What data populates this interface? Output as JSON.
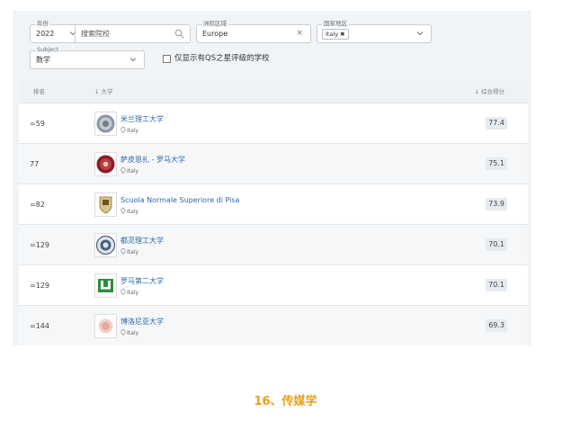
{
  "filters": {
    "year": {
      "legend": "年份",
      "value": "2022"
    },
    "search": {
      "placeholder": "搜索院校"
    },
    "region": {
      "legend": "洲际区域",
      "value": "Europe",
      "clear": "×"
    },
    "country": {
      "legend": "国家地区",
      "chip": "Italy",
      "chip_remove": "✖"
    },
    "subject": {
      "legend": "Subject",
      "value": "数学"
    },
    "qs_only": {
      "label": "仅显示有QS之星评级的学校",
      "checked": false
    }
  },
  "table": {
    "headers": {
      "rank": "排名",
      "university": "↓ 大学",
      "score": "↓ 综合得分"
    },
    "rows": [
      {
        "rank": "=59",
        "name": "米兰理工大学",
        "location": "Italy",
        "score": "77.4",
        "logo_icon": "seal-logo-icon"
      },
      {
        "rank": "77",
        "name": "萨皮恩扎 - 罗马大学",
        "location": "Italy",
        "score": "75.1",
        "logo_icon": "red-seal-logo-icon"
      },
      {
        "rank": "=82",
        "name": "Scuola Normale Superiore di Pisa",
        "location": "Italy",
        "score": "73.9",
        "logo_icon": "crest-logo-icon"
      },
      {
        "rank": "=129",
        "name": "都灵理工大学",
        "location": "Italy",
        "score": "70.1",
        "logo_icon": "emblem-logo-icon"
      },
      {
        "rank": "=129",
        "name": "罗马第二大学",
        "location": "Italy",
        "score": "70.1",
        "logo_icon": "green-logo-icon"
      },
      {
        "rank": "=144",
        "name": "博洛尼亚大学",
        "location": "Italy",
        "score": "69.3",
        "logo_icon": "pink-seal-logo-icon"
      }
    ]
  },
  "footer": {
    "caption": "16、传媒学"
  },
  "colors": {
    "link": "#2a6aa8",
    "accent": "#e8a019",
    "panel": "#f1f4f6"
  }
}
